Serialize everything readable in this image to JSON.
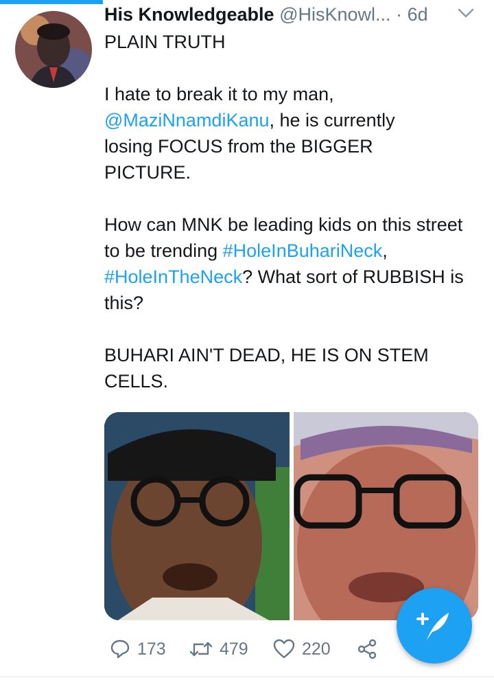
{
  "tweet": {
    "display_name": "His Knowledgeable",
    "handle": "@HisKnowl...",
    "separator": "·",
    "time": "6d",
    "body": {
      "line1": "PLAIN TRUTH",
      "p2_a": "I hate to break it to my man, ",
      "p2_mention": "@MaziNnamdiKanu",
      "p2_b": ", he is currently losing FOCUS from the BIGGER PICTURE.",
      "p3_a": "How can MNK be leading kids on this street to be trending ",
      "p3_tag1": "#HoleInBuhariNeck",
      "p3_sep": ", ",
      "p3_tag2": "#HoleInTheNeck",
      "p3_b": "? What sort of RUBBISH is this?",
      "p4": "BUHARI AIN'T DEAD, HE IS ON STEM CELLS."
    },
    "counts": {
      "replies": "173",
      "retweets": "479",
      "likes": "220"
    }
  },
  "colors": {
    "link": "#1da1f2",
    "secondary_text": "#657786",
    "fab": "#1da1f2"
  },
  "icons": [
    "reply-icon",
    "retweet-icon",
    "like-icon",
    "share-icon",
    "compose-tweet-icon",
    "chevron-down-icon"
  ]
}
